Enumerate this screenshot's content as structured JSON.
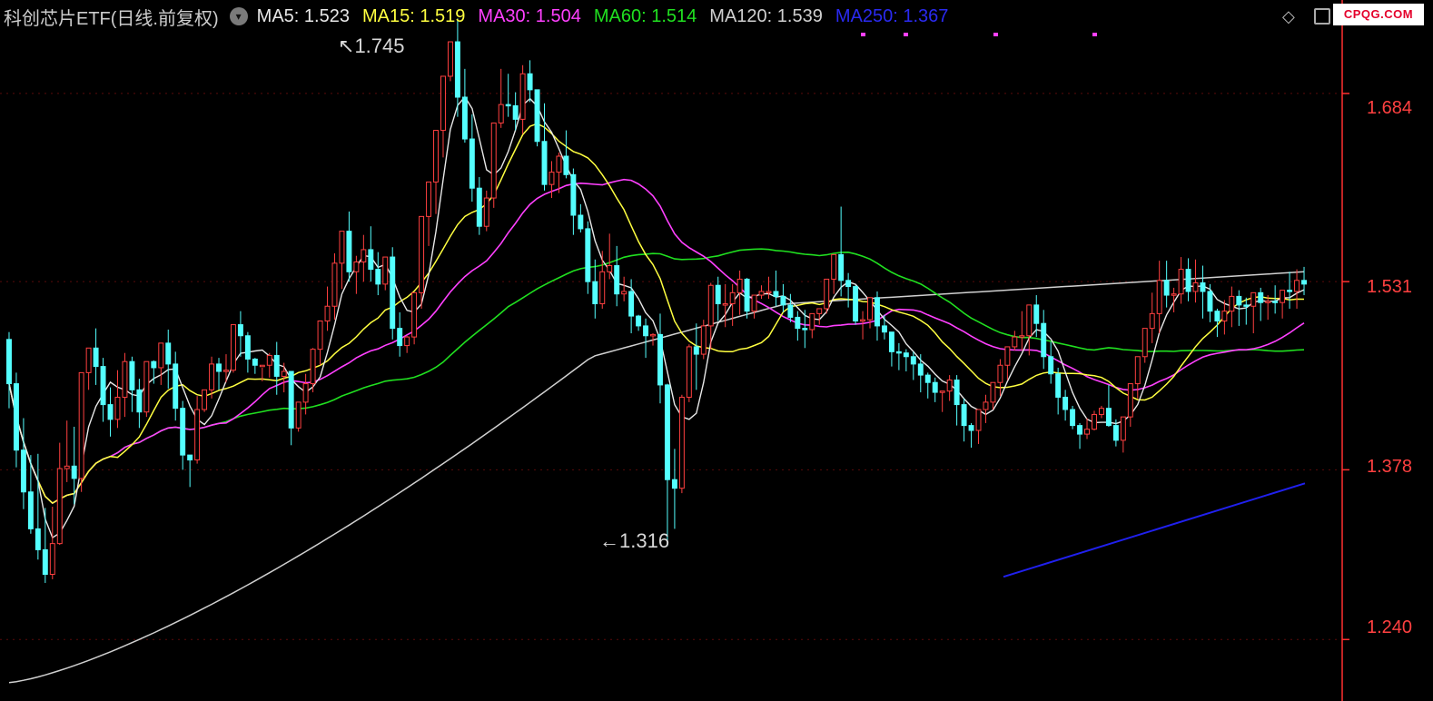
{
  "header": {
    "title": "科创芯片ETF(日线.前复权)",
    "toggle_icon": "chevron-down-icon",
    "window_icon": "window-restore-icon",
    "diamond_icon": "diamond-icon",
    "watermark": "CPQG.COM"
  },
  "chart_data": {
    "type": "candlestick",
    "title": "科创芯片ETF(日线.前复权)",
    "y_ticks": [
      "1.684",
      "1.531",
      "1.378",
      "1.240"
    ],
    "y_range": [
      1.19,
      1.76
    ],
    "grid": true,
    "annotations": [
      {
        "label": "1.745",
        "kind": "period-high"
      },
      {
        "label": "1.316",
        "kind": "period-low"
      }
    ],
    "ma_legend": [
      {
        "name": "MA5",
        "value": "1.523",
        "color": "#e8e8e8"
      },
      {
        "name": "MA15",
        "value": "1.519",
        "color": "#ffff40"
      },
      {
        "name": "MA30",
        "value": "1.504",
        "color": "#ff40ff"
      },
      {
        "name": "MA60",
        "value": "1.514",
        "color": "#20e020"
      },
      {
        "name": "MA120",
        "value": "1.539",
        "color": "#d0d0d0"
      },
      {
        "name": "MA250",
        "value": "1.367",
        "color": "#2020ee"
      }
    ],
    "colors": {
      "up": "#ff4040",
      "down": "#54ffff",
      "grid": "#5a0a0a",
      "axis": "#ff3030"
    },
    "candles": [
      [
        1.484,
        1.49,
        1.448,
        1.428
      ],
      [
        1.448,
        1.457,
        1.394,
        1.38
      ],
      [
        1.394,
        1.42,
        1.36,
        1.346
      ],
      [
        1.36,
        1.39,
        1.33,
        1.326
      ],
      [
        1.33,
        1.391,
        1.313,
        1.305
      ],
      [
        1.313,
        1.347,
        1.293,
        1.286
      ],
      [
        1.293,
        1.348,
        1.318,
        1.289
      ],
      [
        1.318,
        1.4,
        1.379,
        1.317
      ],
      [
        1.379,
        1.418,
        1.381,
        1.368
      ],
      [
        1.381,
        1.413,
        1.371,
        1.35
      ],
      [
        1.371,
        1.455,
        1.457,
        1.36
      ],
      [
        1.457,
        1.469,
        1.477,
        1.443
      ],
      [
        1.477,
        1.493,
        1.462,
        1.447
      ],
      [
        1.462,
        1.469,
        1.431,
        1.417
      ],
      [
        1.431,
        1.445,
        1.419,
        1.405
      ],
      [
        1.419,
        1.459,
        1.437,
        1.412
      ],
      [
        1.437,
        1.473,
        1.466,
        1.421
      ],
      [
        1.466,
        1.47,
        1.443,
        1.425
      ],
      [
        1.443,
        1.452,
        1.425,
        1.412
      ],
      [
        1.425,
        1.434,
        1.466,
        1.421
      ],
      [
        1.466,
        1.467,
        1.461,
        1.448
      ],
      [
        1.461,
        1.478,
        1.481,
        1.447
      ],
      [
        1.481,
        1.492,
        1.464,
        1.444
      ],
      [
        1.464,
        1.474,
        1.428,
        1.418
      ],
      [
        1.428,
        1.434,
        1.39,
        1.378
      ],
      [
        1.39,
        1.39,
        1.386,
        1.364
      ],
      [
        1.386,
        1.438,
        1.427,
        1.383
      ],
      [
        1.427,
        1.439,
        1.443,
        1.425
      ],
      [
        1.443,
        1.47,
        1.464,
        1.436
      ],
      [
        1.464,
        1.469,
        1.458,
        1.443
      ],
      [
        1.458,
        1.472,
        1.459,
        1.449
      ],
      [
        1.459,
        1.495,
        1.496,
        1.457
      ],
      [
        1.496,
        1.507,
        1.487,
        1.47
      ],
      [
        1.487,
        1.49,
        1.468,
        1.457
      ],
      [
        1.468,
        1.469,
        1.463,
        1.456
      ],
      [
        1.463,
        1.461,
        1.463,
        1.45
      ],
      [
        1.463,
        1.473,
        1.471,
        1.453
      ],
      [
        1.471,
        1.482,
        1.454,
        1.439
      ],
      [
        1.454,
        1.465,
        1.458,
        1.441
      ],
      [
        1.458,
        1.451,
        1.412,
        1.398
      ],
      [
        1.412,
        1.43,
        1.433,
        1.409
      ],
      [
        1.433,
        1.456,
        1.448,
        1.423
      ],
      [
        1.448,
        1.477,
        1.476,
        1.441
      ],
      [
        1.476,
        1.484,
        1.499,
        1.463
      ],
      [
        1.499,
        1.527,
        1.511,
        1.491
      ],
      [
        1.511,
        1.554,
        1.546,
        1.5
      ],
      [
        1.546,
        1.568,
        1.572,
        1.525
      ],
      [
        1.572,
        1.588,
        1.539,
        1.531
      ],
      [
        1.539,
        1.552,
        1.547,
        1.521
      ],
      [
        1.547,
        1.569,
        1.557,
        1.531
      ],
      [
        1.557,
        1.576,
        1.541,
        1.531
      ],
      [
        1.541,
        1.555,
        1.529,
        1.52
      ],
      [
        1.529,
        1.544,
        1.551,
        1.524
      ],
      [
        1.551,
        1.559,
        1.493,
        1.484
      ],
      [
        1.493,
        1.506,
        1.479,
        1.47
      ],
      [
        1.479,
        1.487,
        1.486,
        1.473
      ],
      [
        1.486,
        1.494,
        1.522,
        1.48
      ],
      [
        1.522,
        1.545,
        1.584,
        1.509
      ],
      [
        1.584,
        1.608,
        1.612,
        1.56
      ],
      [
        1.612,
        1.647,
        1.654,
        1.586
      ],
      [
        1.654,
        1.697,
        1.698,
        1.632
      ],
      [
        1.698,
        1.722,
        1.726,
        1.694
      ],
      [
        1.726,
        1.745,
        1.681,
        1.665
      ],
      [
        1.681,
        1.704,
        1.647,
        1.644
      ],
      [
        1.647,
        1.667,
        1.607,
        1.596
      ],
      [
        1.607,
        1.616,
        1.576,
        1.569
      ],
      [
        1.576,
        1.605,
        1.599,
        1.572
      ],
      [
        1.599,
        1.643,
        1.66,
        1.591
      ],
      [
        1.66,
        1.704,
        1.675,
        1.656
      ],
      [
        1.675,
        1.7,
        1.674,
        1.665
      ],
      [
        1.674,
        1.685,
        1.663,
        1.654
      ],
      [
        1.663,
        1.707,
        1.7,
        1.651
      ],
      [
        1.7,
        1.711,
        1.687,
        1.677
      ],
      [
        1.687,
        1.687,
        1.645,
        1.641
      ],
      [
        1.645,
        1.676,
        1.61,
        1.605
      ],
      [
        1.61,
        1.629,
        1.62,
        1.599
      ],
      [
        1.62,
        1.636,
        1.633,
        1.603
      ],
      [
        1.633,
        1.654,
        1.618,
        1.615
      ],
      [
        1.618,
        1.623,
        1.585,
        1.569
      ],
      [
        1.585,
        1.594,
        1.574,
        1.571
      ],
      [
        1.574,
        1.58,
        1.531,
        1.521
      ],
      [
        1.531,
        1.549,
        1.513,
        1.501
      ],
      [
        1.513,
        1.556,
        1.539,
        1.509
      ],
      [
        1.539,
        1.57,
        1.544,
        1.533
      ],
      [
        1.544,
        1.56,
        1.521,
        1.511
      ],
      [
        1.521,
        1.535,
        1.523,
        1.515
      ],
      [
        1.523,
        1.533,
        1.503,
        1.489
      ],
      [
        1.503,
        1.504,
        1.495,
        1.491
      ],
      [
        1.495,
        1.501,
        1.487,
        1.469
      ],
      [
        1.487,
        1.489,
        1.488,
        1.479
      ],
      [
        1.488,
        1.505,
        1.447,
        1.432
      ],
      [
        1.447,
        1.448,
        1.37,
        1.316
      ],
      [
        1.37,
        1.395,
        1.363,
        1.33
      ],
      [
        1.363,
        1.439,
        1.437,
        1.359
      ],
      [
        1.437,
        1.48,
        1.478,
        1.433
      ],
      [
        1.478,
        1.497,
        1.472,
        1.443
      ],
      [
        1.472,
        1.5,
        1.495,
        1.468
      ],
      [
        1.495,
        1.53,
        1.528,
        1.476
      ],
      [
        1.528,
        1.535,
        1.513,
        1.499
      ],
      [
        1.513,
        1.529,
        1.513,
        1.494
      ],
      [
        1.513,
        1.529,
        1.522,
        1.495
      ],
      [
        1.522,
        1.54,
        1.533,
        1.504
      ],
      [
        1.533,
        1.534,
        1.507,
        1.501
      ],
      [
        1.507,
        1.519,
        1.52,
        1.501
      ],
      [
        1.52,
        1.528,
        1.523,
        1.517
      ],
      [
        1.523,
        1.535,
        1.523,
        1.517
      ],
      [
        1.523,
        1.54,
        1.519,
        1.511
      ],
      [
        1.519,
        1.529,
        1.512,
        1.506
      ],
      [
        1.512,
        1.521,
        1.502,
        1.498
      ],
      [
        1.502,
        1.507,
        1.493,
        1.483
      ],
      [
        1.493,
        1.508,
        1.492,
        1.477
      ],
      [
        1.492,
        1.499,
        1.505,
        1.485
      ],
      [
        1.505,
        1.509,
        1.509,
        1.496
      ],
      [
        1.509,
        1.526,
        1.533,
        1.505
      ],
      [
        1.533,
        1.536,
        1.553,
        1.521
      ],
      [
        1.553,
        1.592,
        1.532,
        1.519
      ],
      [
        1.532,
        1.538,
        1.527,
        1.51
      ],
      [
        1.527,
        1.528,
        1.499,
        1.496
      ],
      [
        1.499,
        1.507,
        1.5,
        1.484
      ],
      [
        1.5,
        1.515,
        1.518,
        1.493
      ],
      [
        1.518,
        1.523,
        1.495,
        1.483
      ],
      [
        1.495,
        1.504,
        1.49,
        1.484
      ],
      [
        1.49,
        1.49,
        1.474,
        1.462
      ],
      [
        1.474,
        1.481,
        1.473,
        1.459
      ],
      [
        1.473,
        1.476,
        1.47,
        1.458
      ],
      [
        1.47,
        1.474,
        1.464,
        1.451
      ],
      [
        1.464,
        1.472,
        1.455,
        1.441
      ],
      [
        1.455,
        1.457,
        1.449,
        1.436
      ],
      [
        1.449,
        1.453,
        1.441,
        1.433
      ],
      [
        1.441,
        1.441,
        1.442,
        1.425
      ],
      [
        1.442,
        1.455,
        1.451,
        1.434
      ],
      [
        1.451,
        1.455,
        1.431,
        1.414
      ],
      [
        1.431,
        1.436,
        1.414,
        1.401
      ],
      [
        1.414,
        1.416,
        1.41,
        1.396
      ],
      [
        1.41,
        1.421,
        1.427,
        1.399
      ],
      [
        1.427,
        1.439,
        1.433,
        1.416
      ],
      [
        1.433,
        1.443,
        1.449,
        1.427
      ],
      [
        1.449,
        1.468,
        1.463,
        1.438
      ],
      [
        1.463,
        1.477,
        1.478,
        1.451
      ],
      [
        1.478,
        1.491,
        1.486,
        1.475
      ],
      [
        1.486,
        1.507,
        1.487,
        1.475
      ],
      [
        1.487,
        1.507,
        1.512,
        1.471
      ],
      [
        1.512,
        1.52,
        1.497,
        1.486
      ],
      [
        1.497,
        1.508,
        1.47,
        1.46
      ],
      [
        1.47,
        1.482,
        1.456,
        1.448
      ],
      [
        1.456,
        1.461,
        1.437,
        1.423
      ],
      [
        1.437,
        1.443,
        1.427,
        1.418
      ],
      [
        1.427,
        1.43,
        1.414,
        1.411
      ],
      [
        1.414,
        1.416,
        1.407,
        1.395
      ],
      [
        1.407,
        1.42,
        1.411,
        1.403
      ],
      [
        1.411,
        1.426,
        1.423,
        1.41
      ],
      [
        1.423,
        1.43,
        1.428,
        1.42
      ],
      [
        1.428,
        1.447,
        1.414,
        1.413
      ],
      [
        1.414,
        1.419,
        1.402,
        1.397
      ],
      [
        1.402,
        1.417,
        1.421,
        1.392
      ],
      [
        1.421,
        1.446,
        1.448,
        1.413
      ],
      [
        1.448,
        1.464,
        1.47,
        1.436
      ],
      [
        1.47,
        1.491,
        1.493,
        1.465
      ],
      [
        1.493,
        1.522,
        1.505,
        1.481
      ],
      [
        1.505,
        1.548,
        1.532,
        1.489
      ],
      [
        1.532,
        1.548,
        1.52,
        1.51
      ],
      [
        1.52,
        1.526,
        1.521,
        1.506
      ],
      [
        1.521,
        1.551,
        1.541,
        1.513
      ],
      [
        1.541,
        1.55,
        1.523,
        1.515
      ],
      [
        1.523,
        1.549,
        1.53,
        1.514
      ],
      [
        1.53,
        1.544,
        1.523,
        1.501
      ],
      [
        1.523,
        1.529,
        1.507,
        1.498
      ],
      [
        1.507,
        1.509,
        1.499,
        1.486
      ],
      [
        1.499,
        1.516,
        1.507,
        1.488
      ],
      [
        1.507,
        1.527,
        1.519,
        1.494
      ],
      [
        1.519,
        1.524,
        1.512,
        1.495
      ],
      [
        1.512,
        1.518,
        1.511,
        1.496
      ],
      [
        1.511,
        1.521,
        1.522,
        1.489
      ],
      [
        1.522,
        1.526,
        1.514,
        1.499
      ],
      [
        1.514,
        1.52,
        1.515,
        1.5
      ],
      [
        1.515,
        1.528,
        1.514,
        1.505
      ],
      [
        1.514,
        1.523,
        1.524,
        1.501
      ],
      [
        1.524,
        1.539,
        1.523,
        1.509
      ],
      [
        1.523,
        1.541,
        1.532,
        1.509
      ],
      [
        1.532,
        1.543,
        1.529,
        1.52
      ]
    ],
    "ma250_segment": [
      1.291,
      1.367
    ]
  }
}
